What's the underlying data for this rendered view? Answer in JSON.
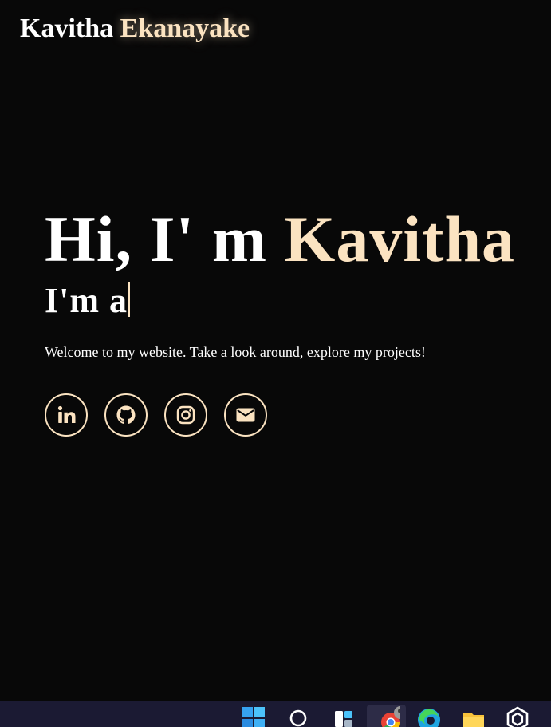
{
  "header": {
    "logo_first": "Kavitha",
    "logo_last": "Ekanayake"
  },
  "hero": {
    "greeting": "Hi, I' m",
    "name": "Kavitha",
    "typing_prefix": "I'm a",
    "welcome": "Welcome to my website. Take a look around, explore my projects!"
  },
  "socials": [
    {
      "name": "linkedin-icon"
    },
    {
      "name": "github-icon"
    },
    {
      "name": "instagram-icon"
    },
    {
      "name": "mail-icon"
    }
  ],
  "taskbar": {
    "items": [
      "windows-start-icon",
      "search-icon",
      "task-view-icon",
      "chrome-icon",
      "edge-icon",
      "file-explorer-icon",
      "app-icon"
    ]
  },
  "colors": {
    "background": "#080808",
    "accent": "#fbe3c1",
    "text": "#ffffff",
    "taskbar": "#1b1a33"
  }
}
